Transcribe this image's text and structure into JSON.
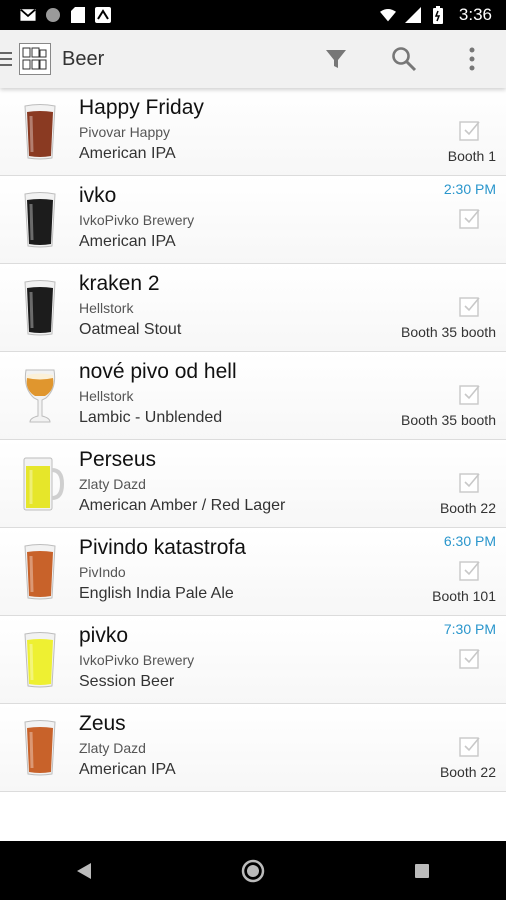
{
  "status_bar": {
    "time": "3:36",
    "icons": [
      "gmail-icon",
      "circle-icon",
      "sd-card-icon",
      "untappd-icon",
      "wifi-icon",
      "signal-icon",
      "battery-icon"
    ]
  },
  "app_bar": {
    "title": "Beer",
    "actions": [
      "filter-icon",
      "search-icon",
      "more-vert-icon"
    ]
  },
  "beers": [
    {
      "name": "Happy Friday",
      "brewery": "Pivovar Happy",
      "style": "American IPA",
      "time": "",
      "booth": "Booth 1",
      "glass": "pint",
      "color": "#8a3a22"
    },
    {
      "name": "ivko",
      "brewery": "IvkoPivko Brewery",
      "style": "American IPA",
      "time": "2:30 PM",
      "booth": "",
      "glass": "pint",
      "color": "#1c1c1c"
    },
    {
      "name": "kraken 2",
      "brewery": "Hellstork",
      "style": "Oatmeal Stout",
      "time": "",
      "booth": "Booth 35 booth",
      "glass": "pint",
      "color": "#1c1c1c"
    },
    {
      "name": "nové pivo od hell",
      "brewery": "Hellstork",
      "style": "Lambic - Unblended",
      "time": "",
      "booth": "Booth 35 booth",
      "glass": "tulip",
      "color": "#e0962e"
    },
    {
      "name": "Perseus",
      "brewery": "Zlaty Dazd",
      "style": "American Amber / Red Lager",
      "time": "",
      "booth": "Booth 22",
      "glass": "mug",
      "color": "#e6e62a"
    },
    {
      "name": "Pivindo katastrofa",
      "brewery": "PivIndo",
      "style": "English India Pale Ale",
      "time": "6:30 PM",
      "booth": "Booth 101",
      "glass": "pint",
      "color": "#c8622a"
    },
    {
      "name": "pivko",
      "brewery": "IvkoPivko Brewery",
      "style": "Session Beer",
      "time": "7:30 PM",
      "booth": "",
      "glass": "pint",
      "color": "#eef032"
    },
    {
      "name": "Zeus",
      "brewery": "Zlaty Dazd",
      "style": "American IPA",
      "time": "",
      "booth": "Booth 22",
      "glass": "pint",
      "color": "#c8622a"
    }
  ],
  "nav_bar": [
    "back-icon",
    "home-icon",
    "recents-icon"
  ]
}
